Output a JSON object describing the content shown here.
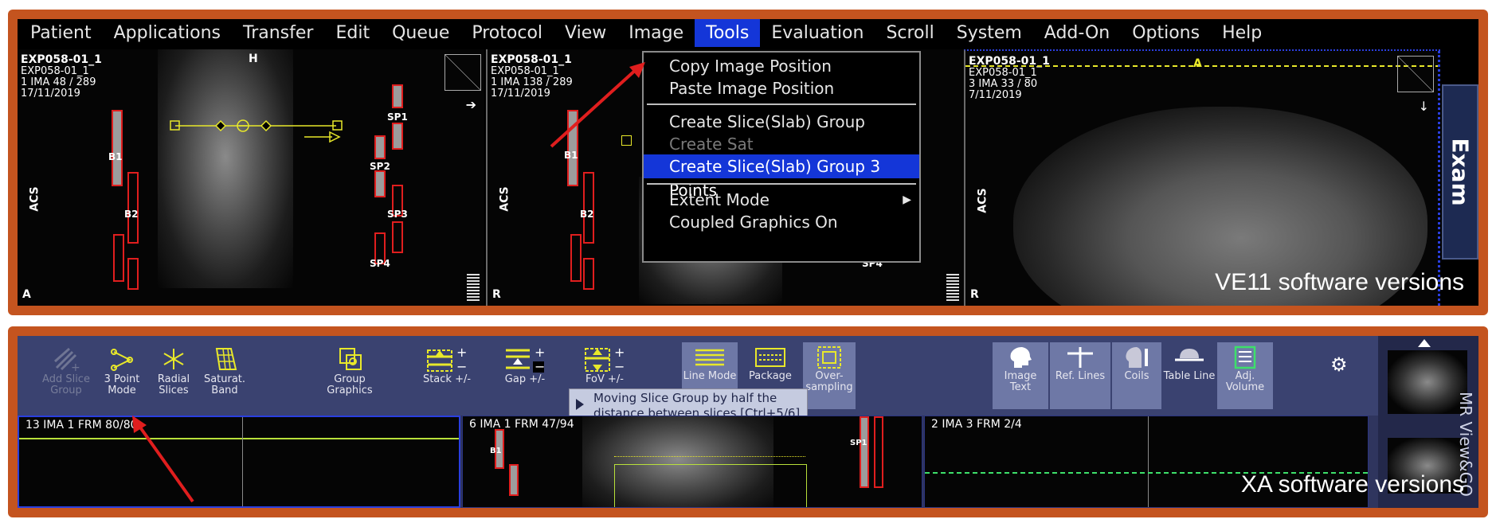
{
  "top": {
    "menu": [
      "Patient",
      "Applications",
      "Transfer",
      "Edit",
      "Queue",
      "Protocol",
      "View",
      "Image",
      "Tools",
      "Evaluation",
      "Scroll",
      "System",
      "Add-On",
      "Options",
      "Help"
    ],
    "active_menu": "Tools",
    "dropdown": {
      "copy": "Copy Image Position",
      "paste": "Paste Image Position",
      "create_group": "Create Slice(Slab) Group",
      "create_sat": "Create Sat",
      "create_group_3pts": "Create Slice(Slab) Group 3 Points",
      "extent_mode": "Extent Mode",
      "coupled": "Coupled Graphics On"
    },
    "viewports": [
      {
        "name": "EXP058-01_1",
        "sub": "EXP058-01_1",
        "ima": "1 IMA 48 / 289",
        "date": "17/11/2019",
        "orient_left": "ACS",
        "corner": "A",
        "top_label": "H"
      },
      {
        "name": "EXP058-01_1",
        "sub": "EXP058-01_1",
        "ima": "1 IMA 138 / 289",
        "date": "17/11/2019",
        "orient_left": "ACS",
        "corner": "R"
      },
      {
        "name": "EXP058-01_1",
        "sub": "EXP058-01_1",
        "ima": "3 IMA 33 / 80",
        "date": "7/11/2019",
        "orient_left": "ACS",
        "corner": "R",
        "top_label": "A"
      }
    ],
    "labels": {
      "b1": "B1",
      "b2": "B2",
      "sp1": "SP1",
      "sp2": "SP2",
      "sp3": "SP3",
      "sp4": "SP4"
    },
    "exam_tab": "Exam",
    "caption": "VE11 software versions"
  },
  "bottom": {
    "tools": {
      "add_slice_group": "Add Slice Group",
      "three_point": "3 Point Mode",
      "radial": "Radial Slices",
      "saturat": "Saturat. Band",
      "group_graphics": "Group Graphics",
      "stack": "Stack +/-",
      "gap": "Gap +/-",
      "fov": "FoV +/-",
      "line_mode": "Line Mode",
      "package": "Package",
      "oversampling": "Over-sampling",
      "image_text": "Image Text",
      "ref_lines": "Ref. Lines",
      "coils": "Coils",
      "table_line": "Table Line",
      "adj_volume": "Adj. Volume"
    },
    "tooltip": "Moving Slice Group by half the distance between slices [Ctrl+5/6]",
    "viewports": [
      {
        "info": "13 IMA 1 FRM 80/80"
      },
      {
        "info": "6 IMA 1 FRM 47/94"
      },
      {
        "info": "2 IMA 3 FRM 2/4"
      }
    ],
    "labels": {
      "b1": "B1",
      "sp1": "SP1"
    },
    "side_label": "MR View&GO",
    "caption": "XA software versions"
  },
  "colors": {
    "frame": "#c4541f",
    "menu_active": "#1436d8",
    "toolbar": "#3a4270",
    "red_bar": "#e01e1e",
    "graphic_yellow": "#e8e82a"
  }
}
